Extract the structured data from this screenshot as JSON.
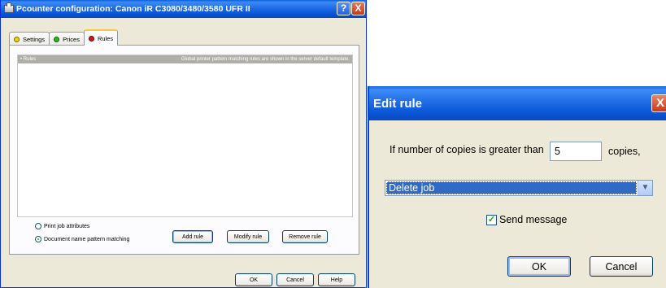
{
  "config_window": {
    "title": "Pcounter configuration: Canon iR C3080/3480/3580 UFR II",
    "help_button": "?",
    "close_button": "X",
    "tabs": [
      {
        "label": "Settings",
        "dot_color": "#f2d400"
      },
      {
        "label": "Prices",
        "dot_color": "#20c020"
      },
      {
        "label": "Rules",
        "dot_color": "#e01010"
      }
    ],
    "rules_header_left": "• Rules",
    "rules_header_right": "Global printer pattern matching rules are shown in the server default template.",
    "radio_print_job": "Print job attributes",
    "radio_doc_name": "Document name pattern matching",
    "add_rule": "Add rule",
    "modify_rule": "Modify rule",
    "remove_rule": "Remove rule",
    "ok": "OK",
    "cancel": "Cancel",
    "help": "Help"
  },
  "edit_rule": {
    "title": "Edit rule",
    "close_button": "X",
    "copies_label": "If number of copies is greater than",
    "copies_value": "5",
    "copies_suffix": "copies,",
    "action_selected": "Delete job",
    "send_message_label": "Send message",
    "send_message_checked": true,
    "ok": "OK",
    "cancel": "Cancel"
  }
}
